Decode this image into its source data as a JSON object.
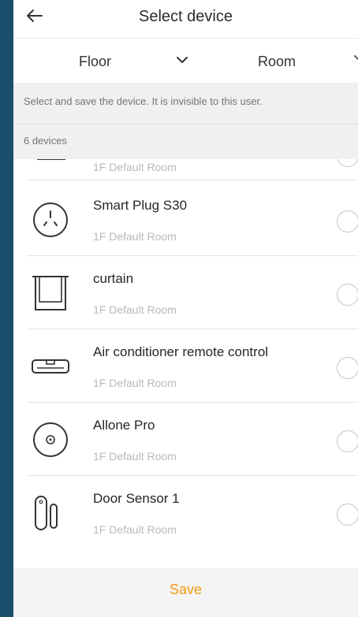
{
  "header": {
    "title": "Select device",
    "back_icon": "arrow-left-icon"
  },
  "filters": {
    "floor_label": "Floor",
    "room_label": "Room",
    "chevron_icon": "chevron-down-icon"
  },
  "notice": {
    "text": "Select and save the device. It is invisible to this user.",
    "count": "6 devices"
  },
  "devices": [
    {
      "name": "",
      "room": "1F Default Room",
      "icon": "lamp-icon"
    },
    {
      "name": "Smart Plug S30",
      "room": "1F Default Room",
      "icon": "smart-plug-icon"
    },
    {
      "name": "curtain",
      "room": "1F Default Room",
      "icon": "curtain-icon"
    },
    {
      "name": "Air conditioner remote control",
      "room": "1F Default Room",
      "icon": "air-conditioner-icon"
    },
    {
      "name": "Allone Pro",
      "room": "1F Default Room",
      "icon": "allone-pro-icon"
    },
    {
      "name": "Door Sensor 1",
      "room": "1F Default Room",
      "icon": "door-sensor-icon"
    }
  ],
  "footer": {
    "save_label": "Save"
  },
  "colors": {
    "accent": "#f09a12",
    "background_frame": "#1b4f6b"
  }
}
